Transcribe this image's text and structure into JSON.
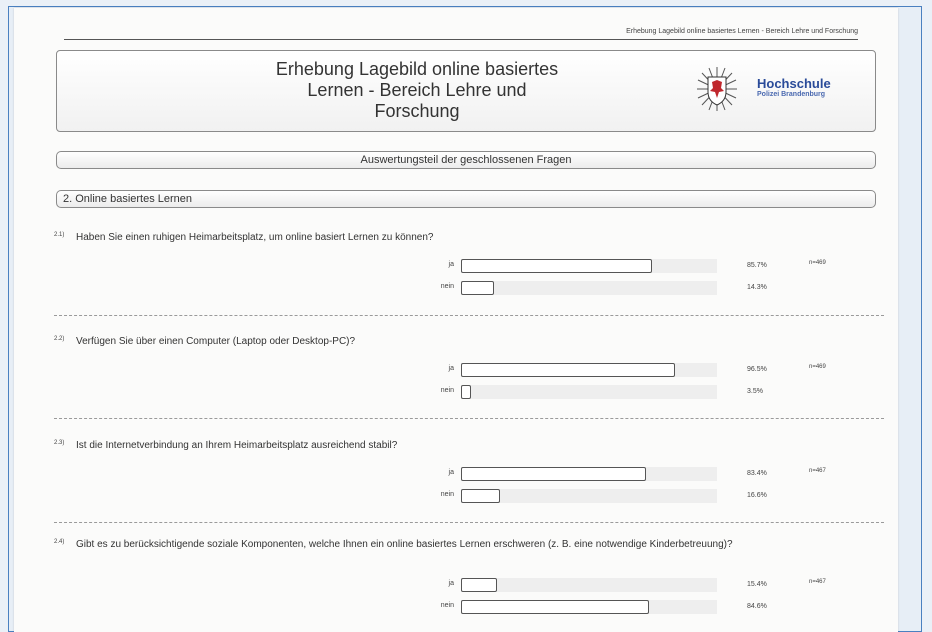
{
  "header": {
    "running_head": "Erhebung Lagebild online basiertes Lernen - Bereich Lehre und Forschung",
    "title_lines": [
      "Erhebung Lagebild online basiertes",
      "Lernen - Bereich Lehre und",
      "Forschung"
    ],
    "school_name": "Hochschule",
    "school_sub": "Polizei Brandenburg",
    "crest_icon": "brandenburg-eagle-crest-icon"
  },
  "sections": {
    "closed_questions": "Auswertungsteil der geschlossenen Fragen",
    "online_learning": "2. Online basiertes Lernen"
  },
  "questions": [
    {
      "number": "2.1)",
      "text": "Haben Sie einen ruhigen Heimarbeitsplatz, um online basiert Lernen zu können?",
      "n": "n=469",
      "answers": [
        {
          "label": "ja",
          "percent_text": "85.7%",
          "value": 85.7
        },
        {
          "label": "nein",
          "percent_text": "14.3%",
          "value": 14.3
        }
      ]
    },
    {
      "number": "2.2)",
      "text": "Verfügen Sie über einen Computer (Laptop oder Desktop-PC)?",
      "n": "n=469",
      "answers": [
        {
          "label": "ja",
          "percent_text": "96.5%",
          "value": 96.5
        },
        {
          "label": "nein",
          "percent_text": "3.5%",
          "value": 3.5
        }
      ]
    },
    {
      "number": "2.3)",
      "text": "Ist die Internetverbindung an Ihrem Heimarbeitsplatz ausreichend stabil?",
      "n": "n=467",
      "answers": [
        {
          "label": "ja",
          "percent_text": "83.4%",
          "value": 83.4
        },
        {
          "label": "nein",
          "percent_text": "16.6%",
          "value": 16.6
        }
      ]
    },
    {
      "number": "2.4)",
      "text": "Gibt es zu berücksichtigende soziale Komponenten, welche Ihnen ein online basiertes Lernen erschweren   (z. B. eine notwendige Kinderbetreuung)?",
      "n": "n=467",
      "answers": [
        {
          "label": "ja",
          "percent_text": "15.4%",
          "value": 15.4
        },
        {
          "label": "nein",
          "percent_text": "84.6%",
          "value": 84.6
        }
      ]
    }
  ]
}
